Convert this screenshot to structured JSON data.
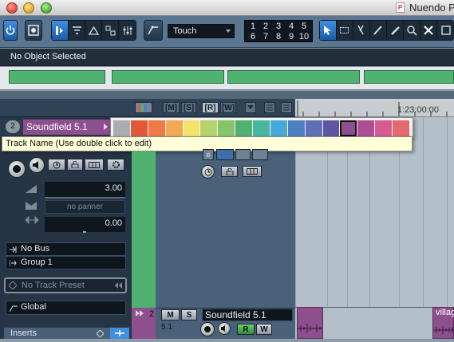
{
  "window": {
    "title": "Nuendo P",
    "app_icon": "P"
  },
  "toolbar": {
    "automation_mode": "Touch",
    "quantize_top": [
      "1",
      "2",
      "3",
      "4",
      "5"
    ],
    "quantize_bottom": [
      "6",
      "7",
      "8",
      "9",
      "10"
    ]
  },
  "infoline": {
    "status": "No Object Selected"
  },
  "ruler": {
    "time": "1:23:00:00"
  },
  "track": {
    "number": "2",
    "name": "Soundfield 5.1",
    "tooltip": "Track Name (Use double click to edit)",
    "volume": "3.00",
    "panner": "no panner",
    "pan_value": "0.00",
    "output_bus": "No Bus",
    "input_group": "Group 1",
    "preset": "No Track Preset",
    "global": "Global",
    "inserts_label": "Inserts",
    "list_name": "Soundfield 5.1",
    "list_format": "5.1",
    "event_label": "villag"
  },
  "palette": {
    "colors": [
      "#a8aeb4",
      "#e05a3a",
      "#ef7a46",
      "#f3a954",
      "#f4e36a",
      "#b6d36c",
      "#86c46a",
      "#4fb271",
      "#48b5a1",
      "#47a9d9",
      "#4f80c2",
      "#6070b8",
      "#5f55a2",
      "#8e4f8e",
      "#b04e93",
      "#d85a93",
      "#e56a6e"
    ],
    "selected_index": 13
  },
  "colors": {
    "track_purple": "#8e4f8e",
    "track_green": "#4fb271"
  },
  "icons": [
    "close-icon",
    "minimize-icon",
    "zoom-icon",
    "power-icon",
    "snap-icon",
    "pointer-icon",
    "range-icon",
    "split-icon",
    "glue-icon",
    "erase-icon",
    "zoom-tool-icon",
    "mute-tool-icon",
    "solo-icon",
    "record-icon"
  ]
}
